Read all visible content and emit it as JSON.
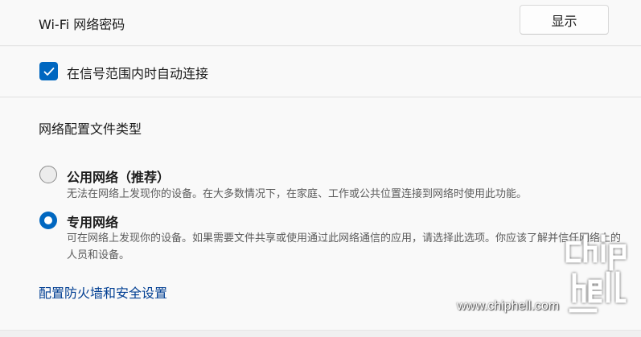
{
  "wifi_password": {
    "label": "Wi-Fi 网络密码",
    "show_button": "显示"
  },
  "auto_connect": {
    "label": "在信号范围内时自动连接",
    "checked": true
  },
  "profile": {
    "heading": "网络配置文件类型",
    "options": [
      {
        "title": "公用网络（推荐）",
        "description": "无法在网络上发现你的设备。在大多数情况下，在家庭、工作或公共位置连接到网络时使用此功能。",
        "selected": false
      },
      {
        "title": "专用网络",
        "description": "可在网络上发现你的设备。如果需要文件共享或使用通过此网络通信的应用，请选择此选项。你应该了解并信任网络上的人员和设备。",
        "selected": true
      }
    ]
  },
  "firewall_link": "配置防火墙和安全设置",
  "watermark": {
    "url": "www.chiphell.com",
    "logo_text": "chiphell"
  },
  "colors": {
    "accent": "#0067c0",
    "link": "#003e92",
    "background": "#f9f9f9"
  },
  "icons": {
    "checkbox": "checkmark-icon",
    "radio_selected": "radio-selected-icon",
    "radio_unselected": "radio-unselected-icon"
  }
}
